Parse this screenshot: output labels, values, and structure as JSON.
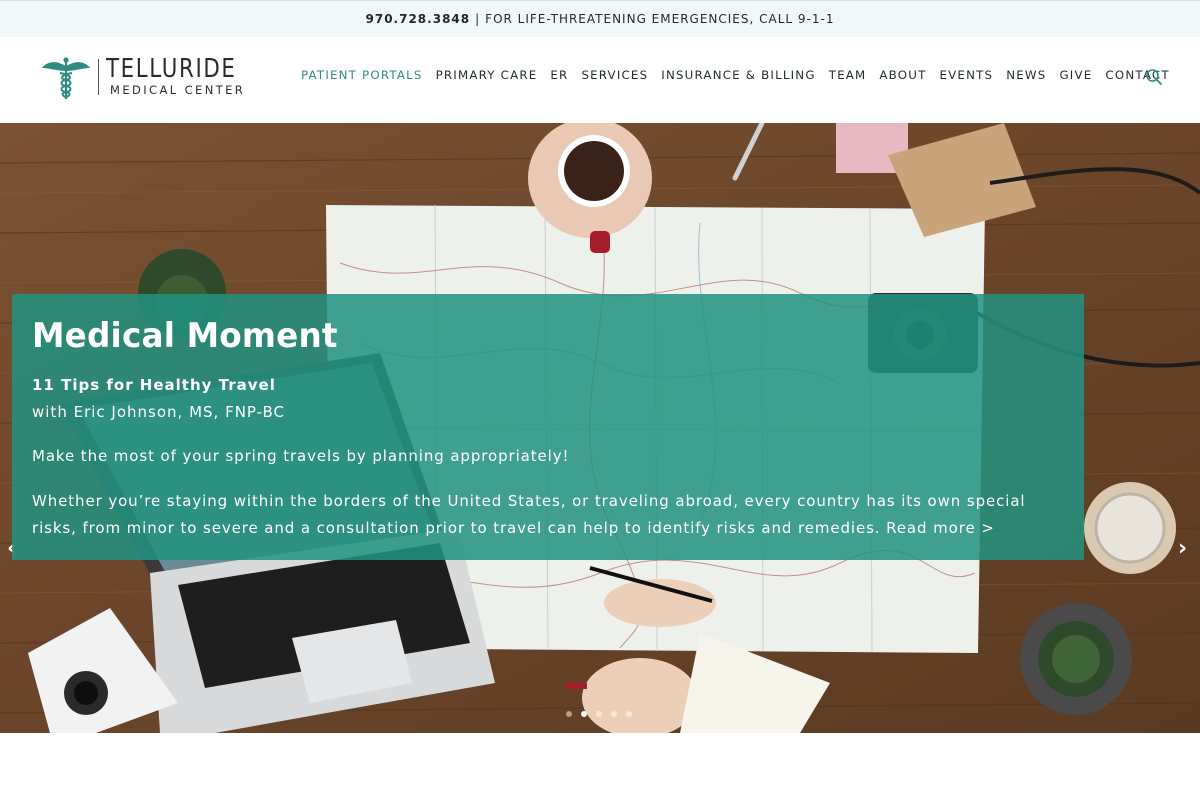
{
  "topbar": {
    "phone": "970.728.3848",
    "separator": "|",
    "emergency": "FOR LIFE-THREATENING EMERGENCIES, CALL 9-1-1"
  },
  "logo": {
    "title": "TELLURIDE",
    "subtitle": "MEDICAL CENTER",
    "icon": "caduceus-icon"
  },
  "nav": {
    "items": [
      {
        "label": "PATIENT PORTALS"
      },
      {
        "label": "PRIMARY CARE"
      },
      {
        "label": "ER"
      },
      {
        "label": "SERVICES"
      },
      {
        "label": "INSURANCE & BILLING"
      },
      {
        "label": "TEAM"
      },
      {
        "label": "ABOUT"
      },
      {
        "label": "EVENTS"
      },
      {
        "label": "NEWS"
      },
      {
        "label": "GIVE"
      },
      {
        "label": "CONTACT"
      }
    ],
    "search_icon": "search-icon"
  },
  "slider": {
    "prev": "‹",
    "next": "›",
    "title": "Medical Moment",
    "subtitle": "11 Tips for Healthy Travel",
    "author": "with Eric Johnson, MS, FNP-BC",
    "lead": "Make the most of your spring travels by planning appropriately!",
    "body": "Whether you’re staying within the borders of the United States, or traveling abroad, every country has its own special risks, from minor to severe and a consultation prior to travel can help to identify risks and remedies.",
    "read_more": "Read more >",
    "slide_count": 5,
    "active_slide": 2
  },
  "colors": {
    "accent": "#2e8c80",
    "overlay": "#229180",
    "topbar_bg": "#f1f8f7"
  }
}
